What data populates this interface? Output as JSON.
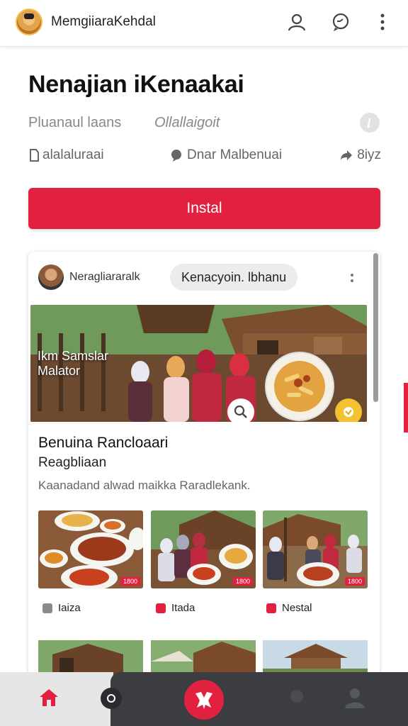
{
  "header": {
    "app_name": "MemgiiaraKehdal",
    "icons": [
      "avatar",
      "person-icon",
      "chat-icon",
      "more-vertical-icon"
    ]
  },
  "page": {
    "title": "Nenajian iKenaakai",
    "subtitle_left": "Pluanaul laans",
    "subtitle_mid": "Ollallaigoit",
    "meta_left": "alalaluraai",
    "meta_mid": "Dnar Malbenuai",
    "meta_right": "8iyz",
    "install_label": "Instal"
  },
  "card": {
    "poster_name": "Neragliararalk",
    "pill_label": "Kenacyoin. lbhanu",
    "hero_caption_line1": "Ikm Samslar",
    "hero_caption_line2": "Malator",
    "post_title": "Benuina Rancloaari",
    "post_subtitle": "Reagbliaan",
    "post_description": "Kaanadand alwad maikka Raradlekank.",
    "thumbnails": [
      {
        "label": "Iaiza",
        "tag": "1800",
        "icon_color": "#888888"
      },
      {
        "label": "Itada",
        "tag": "1800",
        "icon_color": "#e22040"
      },
      {
        "label": "Nestal",
        "tag": "1800",
        "icon_color": "#e22040"
      }
    ]
  },
  "nav": {
    "items": [
      "home-icon",
      "search-icon",
      "center-action-icon",
      "chat-icon",
      "profile-icon"
    ]
  },
  "colors": {
    "accent": "#e22040",
    "nav_dark": "#3b3d42",
    "nav_light": "#e6e6e6"
  }
}
